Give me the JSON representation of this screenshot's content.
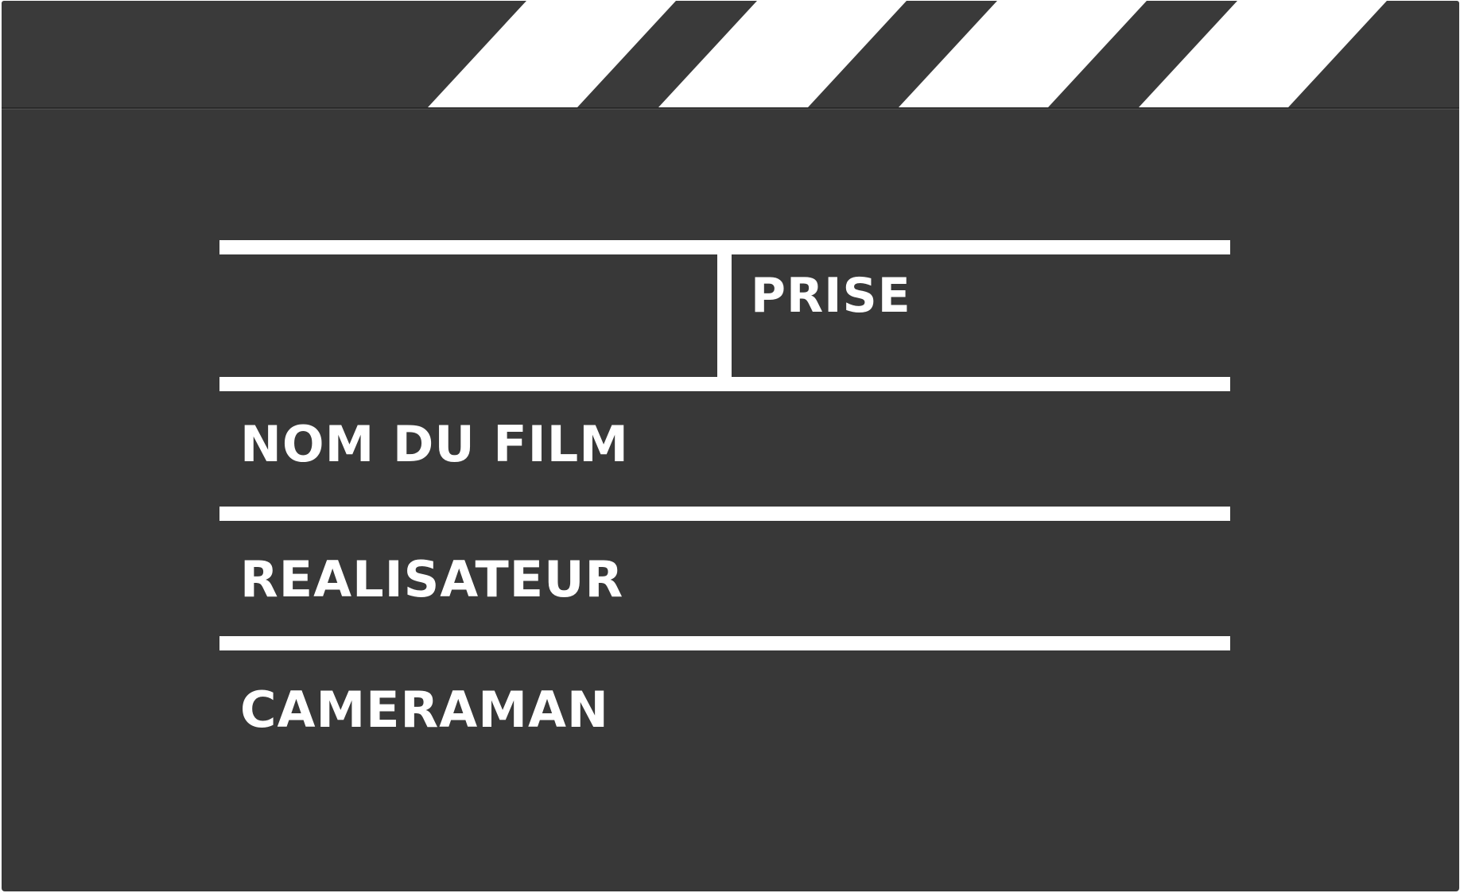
{
  "slate": {
    "labels": {
      "take": "PRISE",
      "film_title": "NOM DU FILM",
      "director": "REALISATEUR",
      "cameraman": "CAMERAMAN"
    },
    "colors": {
      "board": "#383838",
      "stripe_light": "#ffffff",
      "stripe_dark": "#3a3a3a",
      "lines": "#ffffff"
    }
  }
}
